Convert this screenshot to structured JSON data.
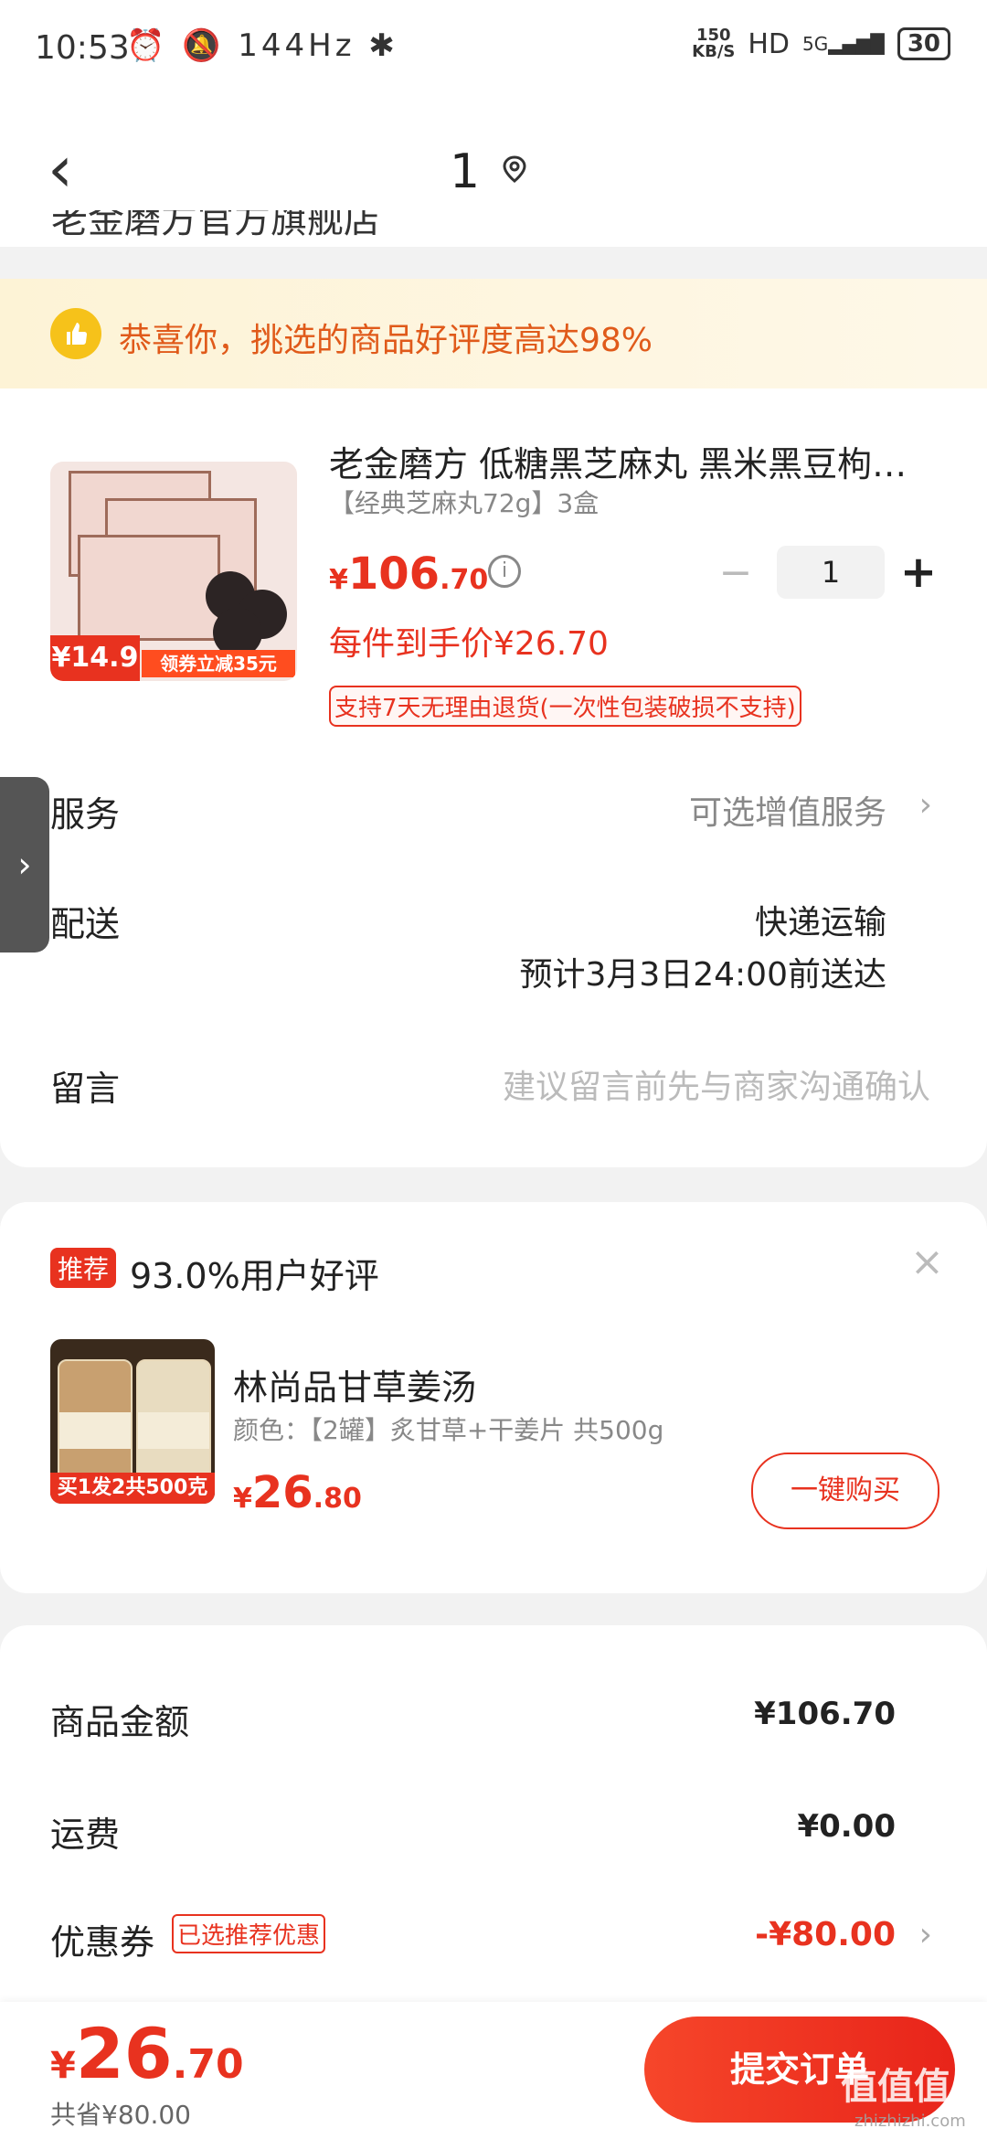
{
  "status_bar": {
    "time": "10:53",
    "icons": "⏰ 🔕 144Hz ✱",
    "speed_value": "150",
    "speed_unit": "KB/S",
    "hd": "HD",
    "network": "5G",
    "battery": "30"
  },
  "header": {
    "back_icon": "chevron-left-icon",
    "title": "1",
    "location_icon": "location-pin-icon",
    "shop_peek": "老金磨方官方旗舰店"
  },
  "banner": {
    "icon": "thumbs-up-icon",
    "text": "恭喜你，挑选的商品好评度高达98%"
  },
  "product": {
    "name": "老金磨方 低糖黑芝麻丸 黑米黑豆枸杞…",
    "spec": "【经典芝麻丸72g】3盒",
    "price_symbol": "¥",
    "price_int": "106",
    "price_dec": ".70",
    "quantity": "1",
    "minus": "−",
    "plus": "+",
    "unit_price": "每件到手价¥26.70",
    "return_policy": "支持7天无理由退货(一次性包装破损不支持)",
    "image_badge_price": "¥14.9",
    "image_badge_coupon": "领券立减35元"
  },
  "rows": {
    "service_label": "服务",
    "service_value": "可选增值服务",
    "delivery_label": "配送",
    "delivery_method": "快递运输",
    "delivery_eta": "预计3月3日24:00前送达",
    "message_label": "留言",
    "message_placeholder": "建议留言前先与商家沟通确认"
  },
  "recommend": {
    "tag": "推荐",
    "rating": "93.0%用户好评",
    "close": "×",
    "name": "林尚品甘草姜汤",
    "spec": "颜色：【2罐】炙甘草+干姜片 共500g",
    "price_symbol": "¥",
    "price_int": "26",
    "price_dec": ".80",
    "buy_label": "一键购买",
    "image_badge": "买1发2共500克"
  },
  "summary": {
    "goods_label": "商品金额",
    "goods_value": "¥106.70",
    "shipping_label": "运费",
    "shipping_value": "¥0.00",
    "coupon_label": "优惠券",
    "coupon_tag": "已选推荐优惠",
    "coupon_value": "-¥80.00"
  },
  "bottom": {
    "total_symbol": "¥",
    "total_int": "26",
    "total_dec": ".70",
    "saved": "共省¥80.00",
    "submit_label": "提交订单"
  },
  "watermark": {
    "main": "值值值",
    "sub": "zhizhizhi.com"
  },
  "colors": {
    "accent": "#e8321f",
    "banner_text": "#e05a1a",
    "banner_bg": "#fdf3d6"
  }
}
